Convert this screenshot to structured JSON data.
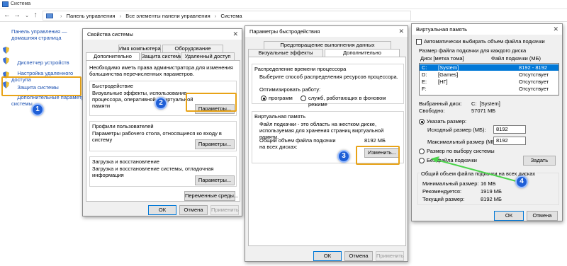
{
  "cp": {
    "window_title": "Система",
    "breadcrumb": [
      "Панель управления",
      "Все элементы панели управления",
      "Система"
    ],
    "sidebar": [
      {
        "label": "Панель управления —\nдомашняя страница",
        "shield": false
      },
      {
        "label": "Диспетчер устройств",
        "shield": true
      },
      {
        "label": "Настройка удаленного\nдоступа",
        "shield": true
      },
      {
        "label": "Защита системы",
        "shield": true
      },
      {
        "label": "Дополнительные параметры\nсистемы",
        "shield": true
      }
    ]
  },
  "sysprops": {
    "title": "Свойства системы",
    "tabs_top": [
      "Имя компьютера",
      "Оборудование"
    ],
    "tabs_bottom": [
      "Дополнительно",
      "Защита системы",
      "Удаленный доступ"
    ],
    "admin_note": "Необходимо иметь права администратора для изменения большинства перечисленных параметров.",
    "perf_title": "Быстродействие",
    "perf_desc": "Визуальные эффекты, использование процессора, оперативной и виртуальной памяти",
    "perf_btn": "Параметры...",
    "profiles_title": "Профили пользователей",
    "profiles_desc": "Параметры рабочего стола, относящиеся ко входу в систему",
    "profiles_btn": "Параметры...",
    "startup_title": "Загрузка и восстановление",
    "startup_desc": "Загрузка и восстановление системы, отладочная информация",
    "startup_btn": "Параметры...",
    "env_btn": "Переменные среды...",
    "ok": "ОК",
    "cancel": "Отмена",
    "apply": "Применить"
  },
  "perfopts": {
    "title": "Параметры быстродействия",
    "tab_top": "Предотвращение выполнения данных",
    "tab_left": "Визуальные эффекты",
    "tab_right": "Дополнительно",
    "cpu_title": "Распределение времени процессора",
    "cpu_desc": "Выберите способ распределения ресурсов процессора.",
    "optimize_label": "Оптимизировать работу:",
    "radio_programs": "программ",
    "radio_services": "служб, работающих в фоновом режиме",
    "vm_title": "Виртуальная память",
    "vm_desc": "Файл подкачки - это область на жестком диске, используемая для хранения страниц виртуальной памяти.",
    "vm_total_label": "Общий объем файла подкачки на всех дисках:",
    "vm_total_value": "8192 МБ",
    "change_btn": "Изменить...",
    "ok": "ОК",
    "cancel": "Отмена",
    "apply": "Применить"
  },
  "vmem": {
    "title": "Виртуальная память",
    "auto_label": "Автоматически выбирать объем файла подкачки",
    "size_header": "Размер файла подкачки для каждого диска",
    "col_disk": "Диск [метка тома]",
    "col_size": "Файл подкачки (МБ)",
    "drives": [
      {
        "letter": "C:",
        "label": "[System]",
        "size": "8192 - 8192",
        "selected": true
      },
      {
        "letter": "D:",
        "label": "[Games]",
        "size": "Отсутствует",
        "selected": false
      },
      {
        "letter": "E:",
        "label": "[HГ]",
        "size": "Отсутствует",
        "selected": false
      },
      {
        "letter": "F:",
        "label": "",
        "size": "Отсутствует",
        "selected": false
      }
    ],
    "selected_disk_label": "Выбранный диск:",
    "selected_disk_value": "C:  [System]",
    "free_label": "Свободно:",
    "free_value": "57071 МБ",
    "radio_custom": "Указать размер:",
    "initial_label": "Исходный размер (МБ):",
    "initial_value": "8192",
    "max_label": "Максимальный размер (МБ):",
    "max_value": "8192",
    "radio_system": "Размер по выбору системы",
    "radio_none": "Без файла подкачки",
    "set_btn": "Задать",
    "total_header": "Общий объем файла подкачки на всех дисках",
    "min_label": "Минимальный размер:",
    "min_value": "16 МБ",
    "rec_label": "Рекомендуется:",
    "rec_value": "1919 МБ",
    "cur_label": "Текущий размер:",
    "cur_value": "8192 МБ",
    "ok": "ОК",
    "cancel": "Отмена"
  },
  "badges": [
    "1",
    "2",
    "3",
    "4"
  ],
  "colors": {
    "accent": "#0078d7",
    "highlight": "#e8a317",
    "badge": "#1f5fd6",
    "arrow": "#4cd44c",
    "link": "#1a4fb0"
  }
}
